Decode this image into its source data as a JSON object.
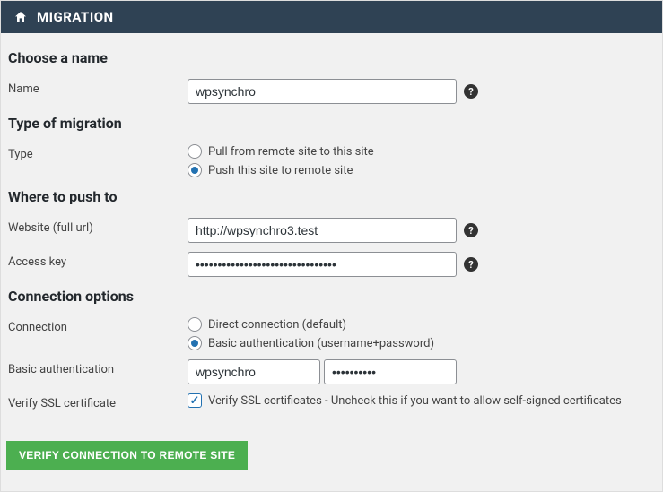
{
  "header": {
    "title": "MIGRATION"
  },
  "sections": {
    "choose_name": {
      "heading": "Choose a name",
      "name_label": "Name",
      "name_value": "wpsynchro"
    },
    "type": {
      "heading": "Type of migration",
      "type_label": "Type",
      "pull_label": "Pull from remote site to this site",
      "push_label": "Push this site to remote site"
    },
    "where": {
      "heading": "Where to push to",
      "website_label": "Website (full url)",
      "website_value": "http://wpsynchro3.test",
      "accesskey_label": "Access key",
      "accesskey_value": "••••••••••••••••••••••••••••••••"
    },
    "conn": {
      "heading": "Connection options",
      "connection_label": "Connection",
      "direct_label": "Direct connection (default)",
      "basic_label": "Basic authentication (username+password)",
      "basicauth_label": "Basic authentication",
      "basic_user": "wpsynchro",
      "basic_pass": "••••••••••",
      "ssl_label": "Verify SSL certificate",
      "ssl_check_label": "Verify SSL certificates - Uncheck this if you want to allow self-signed certificates"
    }
  },
  "button": {
    "verify": "VERIFY CONNECTION TO REMOTE SITE"
  },
  "help_glyph": "?"
}
